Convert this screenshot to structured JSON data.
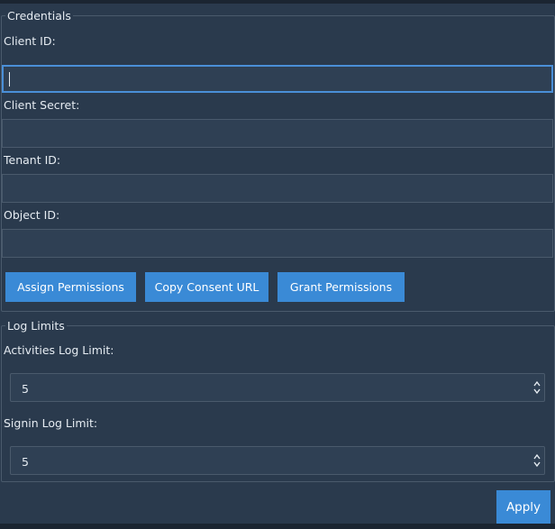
{
  "credentials": {
    "title": "Credentials",
    "client_id_label": "Client ID:",
    "client_id_value": "",
    "client_secret_label": "Client Secret:",
    "client_secret_value": "",
    "tenant_id_label": "Tenant ID:",
    "tenant_id_value": "",
    "object_id_label": "Object ID:",
    "object_id_value": "",
    "buttons": {
      "assign": "Assign Permissions",
      "copy": "Copy Consent URL",
      "grant": "Grant Permissions"
    }
  },
  "log_limits": {
    "title": "Log Limits",
    "activities_label": "Activities Log Limit:",
    "activities_value": "5",
    "signin_label": "Signin Log Limit:",
    "signin_value": "5"
  },
  "footer": {
    "apply_label": "Apply"
  },
  "colors": {
    "background": "#2a3a4d",
    "accent": "#3a8ad6",
    "focus_border": "#4a8fd8"
  }
}
